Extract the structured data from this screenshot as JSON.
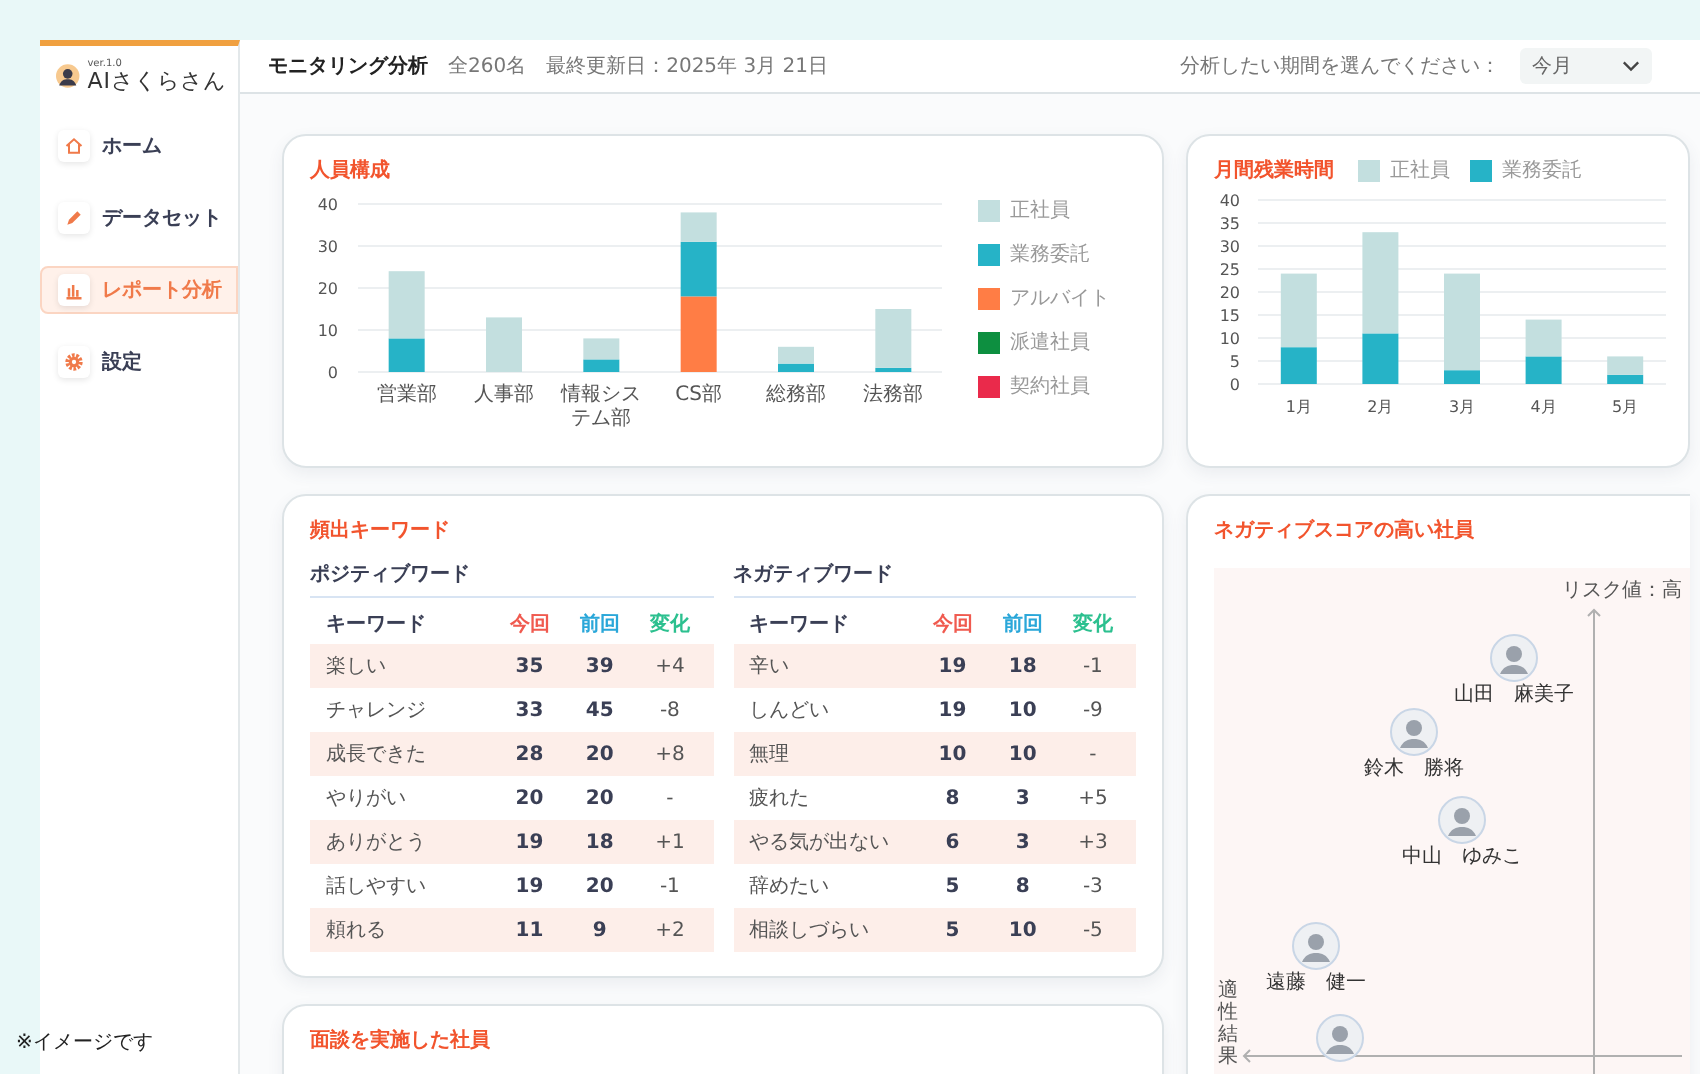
{
  "sidebar": {
    "version": "ver.1.0",
    "app_name": "AIさくらさん",
    "items": [
      {
        "label": "ホーム",
        "selected": false
      },
      {
        "label": "データセット",
        "selected": false
      },
      {
        "label": "レポート分析",
        "selected": true
      },
      {
        "label": "設定",
        "selected": false
      }
    ]
  },
  "header": {
    "title": "モニタリング分析",
    "count": "全260名",
    "updated": "最終更新日：2025年 3月 21日",
    "period_label": "分析したい期間を選んでください：",
    "period_value": "今月"
  },
  "staff_chart": {
    "title": "人員構成",
    "chart_data": {
      "type": "bar",
      "stacked": true,
      "grid": true,
      "categories": [
        "営業部",
        "人事部",
        "情報システム部",
        "CS部",
        "総務部",
        "法務部"
      ],
      "ylim": [
        0,
        40
      ],
      "yticks": [
        0,
        10,
        20,
        30,
        40
      ],
      "series": [
        {
          "name": "正社員",
          "color": "#c3dfdf",
          "values": [
            16,
            13,
            5,
            7,
            4,
            14
          ]
        },
        {
          "name": "業務委託",
          "color": "#26b3c7",
          "values": [
            8,
            0,
            3,
            13,
            2,
            1
          ]
        },
        {
          "name": "アルバイト",
          "color": "#ff7d45",
          "values": [
            0,
            0,
            0,
            18,
            0,
            0
          ]
        },
        {
          "name": "派遣社員",
          "color": "#0d8f40",
          "values": [
            0,
            0,
            0,
            0,
            0,
            0
          ]
        },
        {
          "name": "契約社員",
          "color": "#ea2a4b",
          "values": [
            0,
            0,
            0,
            0,
            0,
            0
          ]
        }
      ]
    }
  },
  "overtime_chart": {
    "title": "月間残業時間",
    "chart_data": {
      "type": "bar",
      "stacked": true,
      "grid": true,
      "categories": [
        "1月",
        "2月",
        "3月",
        "4月",
        "5月"
      ],
      "ylim": [
        0,
        40
      ],
      "yticks": [
        0,
        5,
        10,
        15,
        20,
        25,
        30,
        35,
        40
      ],
      "series": [
        {
          "name": "正社員",
          "color": "#c3dfdf",
          "values": [
            16,
            22,
            21,
            8,
            4
          ]
        },
        {
          "name": "業務委託",
          "color": "#26b3c7",
          "values": [
            8,
            11,
            3,
            6,
            2
          ]
        }
      ]
    }
  },
  "keywords": {
    "title": "頻出キーワード",
    "tables": [
      {
        "title": "ポジティブワード",
        "columns": [
          {
            "label": "キーワード",
            "color": "#3a3f55"
          },
          {
            "label": "今回",
            "color": "#f05a4f"
          },
          {
            "label": "前回",
            "color": "#2aa7d9"
          },
          {
            "label": "変化",
            "color": "#2cc08f"
          }
        ],
        "rows": [
          [
            "楽しい",
            "35",
            "39",
            "+4"
          ],
          [
            "チャレンジ",
            "33",
            "45",
            "-8"
          ],
          [
            "成長できた",
            "28",
            "20",
            "+8"
          ],
          [
            "やりがい",
            "20",
            "20",
            "-"
          ],
          [
            "ありがとう",
            "19",
            "18",
            "+1"
          ],
          [
            "話しやすい",
            "19",
            "20",
            "-1"
          ],
          [
            "頼れる",
            "11",
            "9",
            "+2"
          ]
        ]
      },
      {
        "title": "ネガティブワード",
        "columns": [
          {
            "label": "キーワード",
            "color": "#3a3f55"
          },
          {
            "label": "今回",
            "color": "#f05a4f"
          },
          {
            "label": "前回",
            "color": "#2aa7d9"
          },
          {
            "label": "変化",
            "color": "#2cc08f"
          }
        ],
        "rows": [
          [
            "辛い",
            "19",
            "18",
            "-1"
          ],
          [
            "しんどい",
            "19",
            "10",
            "-9"
          ],
          [
            "無理",
            "10",
            "10",
            "-"
          ],
          [
            "疲れた",
            "8",
            "3",
            "+5"
          ],
          [
            "やる気が出ない",
            "6",
            "3",
            "+3"
          ],
          [
            "辞めたい",
            "5",
            "8",
            "-3"
          ],
          [
            "相談しづらい",
            "5",
            "10",
            "-5"
          ]
        ]
      }
    ]
  },
  "risk_map": {
    "title": "ネガティブスコアの高い社員",
    "y_axis_label": "リスク値：高",
    "x_axis_label": "適性結果",
    "employees": [
      {
        "name": "山田　麻美子"
      },
      {
        "name": "鈴木　勝将"
      },
      {
        "name": "中山　ゆみこ"
      },
      {
        "name": "遠藤　健一"
      }
    ]
  },
  "interview": {
    "title": "面談を実施した社員"
  },
  "footnote": "※イメージです"
}
